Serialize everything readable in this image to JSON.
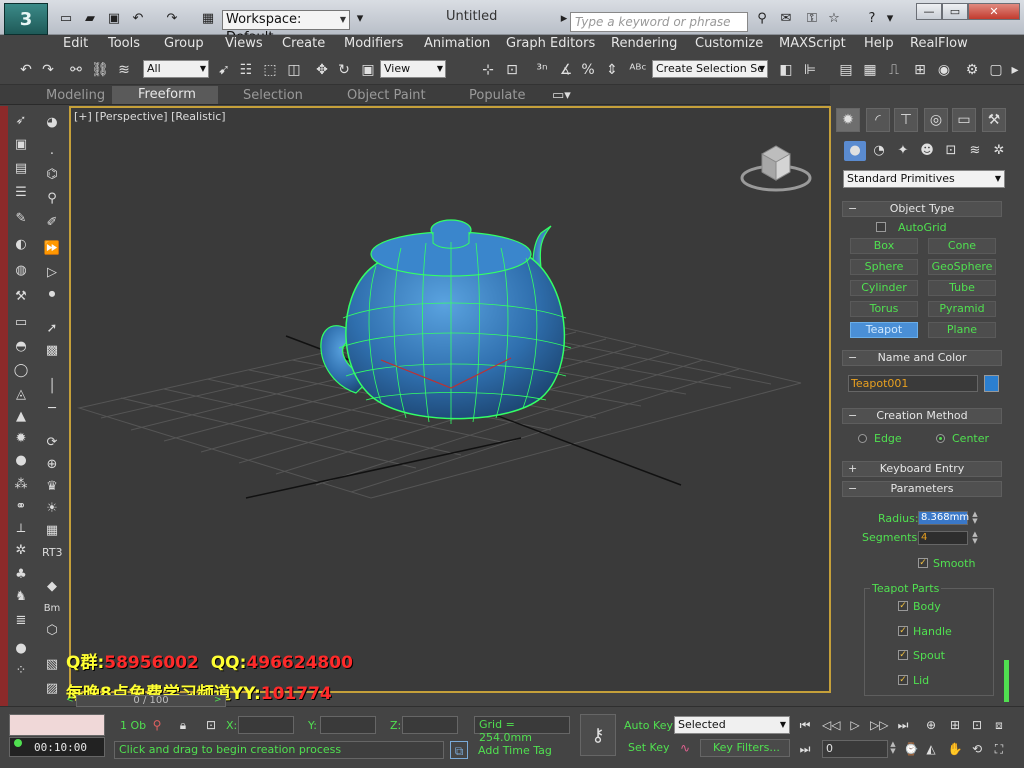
{
  "titlebar": {
    "workspace_label": "Workspace: Default",
    "app_title": "Untitled",
    "search_placeholder": "Type a keyword or phrase"
  },
  "menu": [
    "Edit",
    "Tools",
    "Group",
    "Views",
    "Create",
    "Modifiers",
    "Animation",
    "Graph Editors",
    "Rendering",
    "Customize",
    "MAXScript",
    "Help",
    "RealFlow"
  ],
  "toolbar": {
    "filter_value": "All",
    "refcoord_value": "View",
    "selection_set_placeholder": "Create Selection Se"
  },
  "ribbon": {
    "tabs": [
      "Modeling",
      "Freeform",
      "Selection",
      "Object Paint",
      "Populate"
    ],
    "active_tab": "Freeform"
  },
  "viewport": {
    "label": "[+] [Perspective] [Realistic]",
    "watermark_line1_prefix": "Q群:",
    "watermark_line1_group": "58956002",
    "watermark_line1_qq_label": "QQ:",
    "watermark_line1_qq": "496624800",
    "watermark_line2_prefix": "每晚8点免费学习频道YY:",
    "watermark_line2_yy": "101774"
  },
  "command_panel": {
    "category": "Standard Primitives",
    "object_type": {
      "title": "Object Type",
      "autogrid": "AutoGrid",
      "buttons": [
        "Box",
        "Cone",
        "Sphere",
        "GeoSphere",
        "Cylinder",
        "Tube",
        "Torus",
        "Pyramid",
        "Teapot",
        "Plane"
      ],
      "active": "Teapot"
    },
    "name_and_color": {
      "title": "Name and Color",
      "name": "Teapot001",
      "color": "#2b7fd0"
    },
    "creation_method": {
      "title": "Creation Method",
      "options": [
        "Edge",
        "Center"
      ],
      "selected": "Center"
    },
    "keyboard_entry": "Keyboard Entry",
    "parameters": {
      "title": "Parameters",
      "radius_label": "Radius:",
      "radius_value": "8.368mm",
      "segments_label": "Segments:",
      "segments_value": "4",
      "smooth_label": "Smooth",
      "teapot_parts_label": "Teapot Parts",
      "parts": [
        "Body",
        "Handle",
        "Spout",
        "Lid"
      ]
    }
  },
  "status": {
    "time_slider": "0 / 100",
    "time_display": "00:10:00",
    "selection_count": "1 Ob",
    "x_label": "X:",
    "y_label": "Y:",
    "z_label": "Z:",
    "grid": "Grid = 254.0mm",
    "prompt": "Click and drag to begin creation process",
    "add_time_tag": "Add Time Tag",
    "auto_key": "Auto Key",
    "set_key": "Set Key",
    "key_mode": "Selected",
    "key_filters": "Key Filters...",
    "frame": "0"
  },
  "colors": {
    "viewport_border": "#c5a03a",
    "accent_green": "#50e050",
    "teapot_blue": "#3a7fc4",
    "wireframe_green": "#33ff66"
  }
}
